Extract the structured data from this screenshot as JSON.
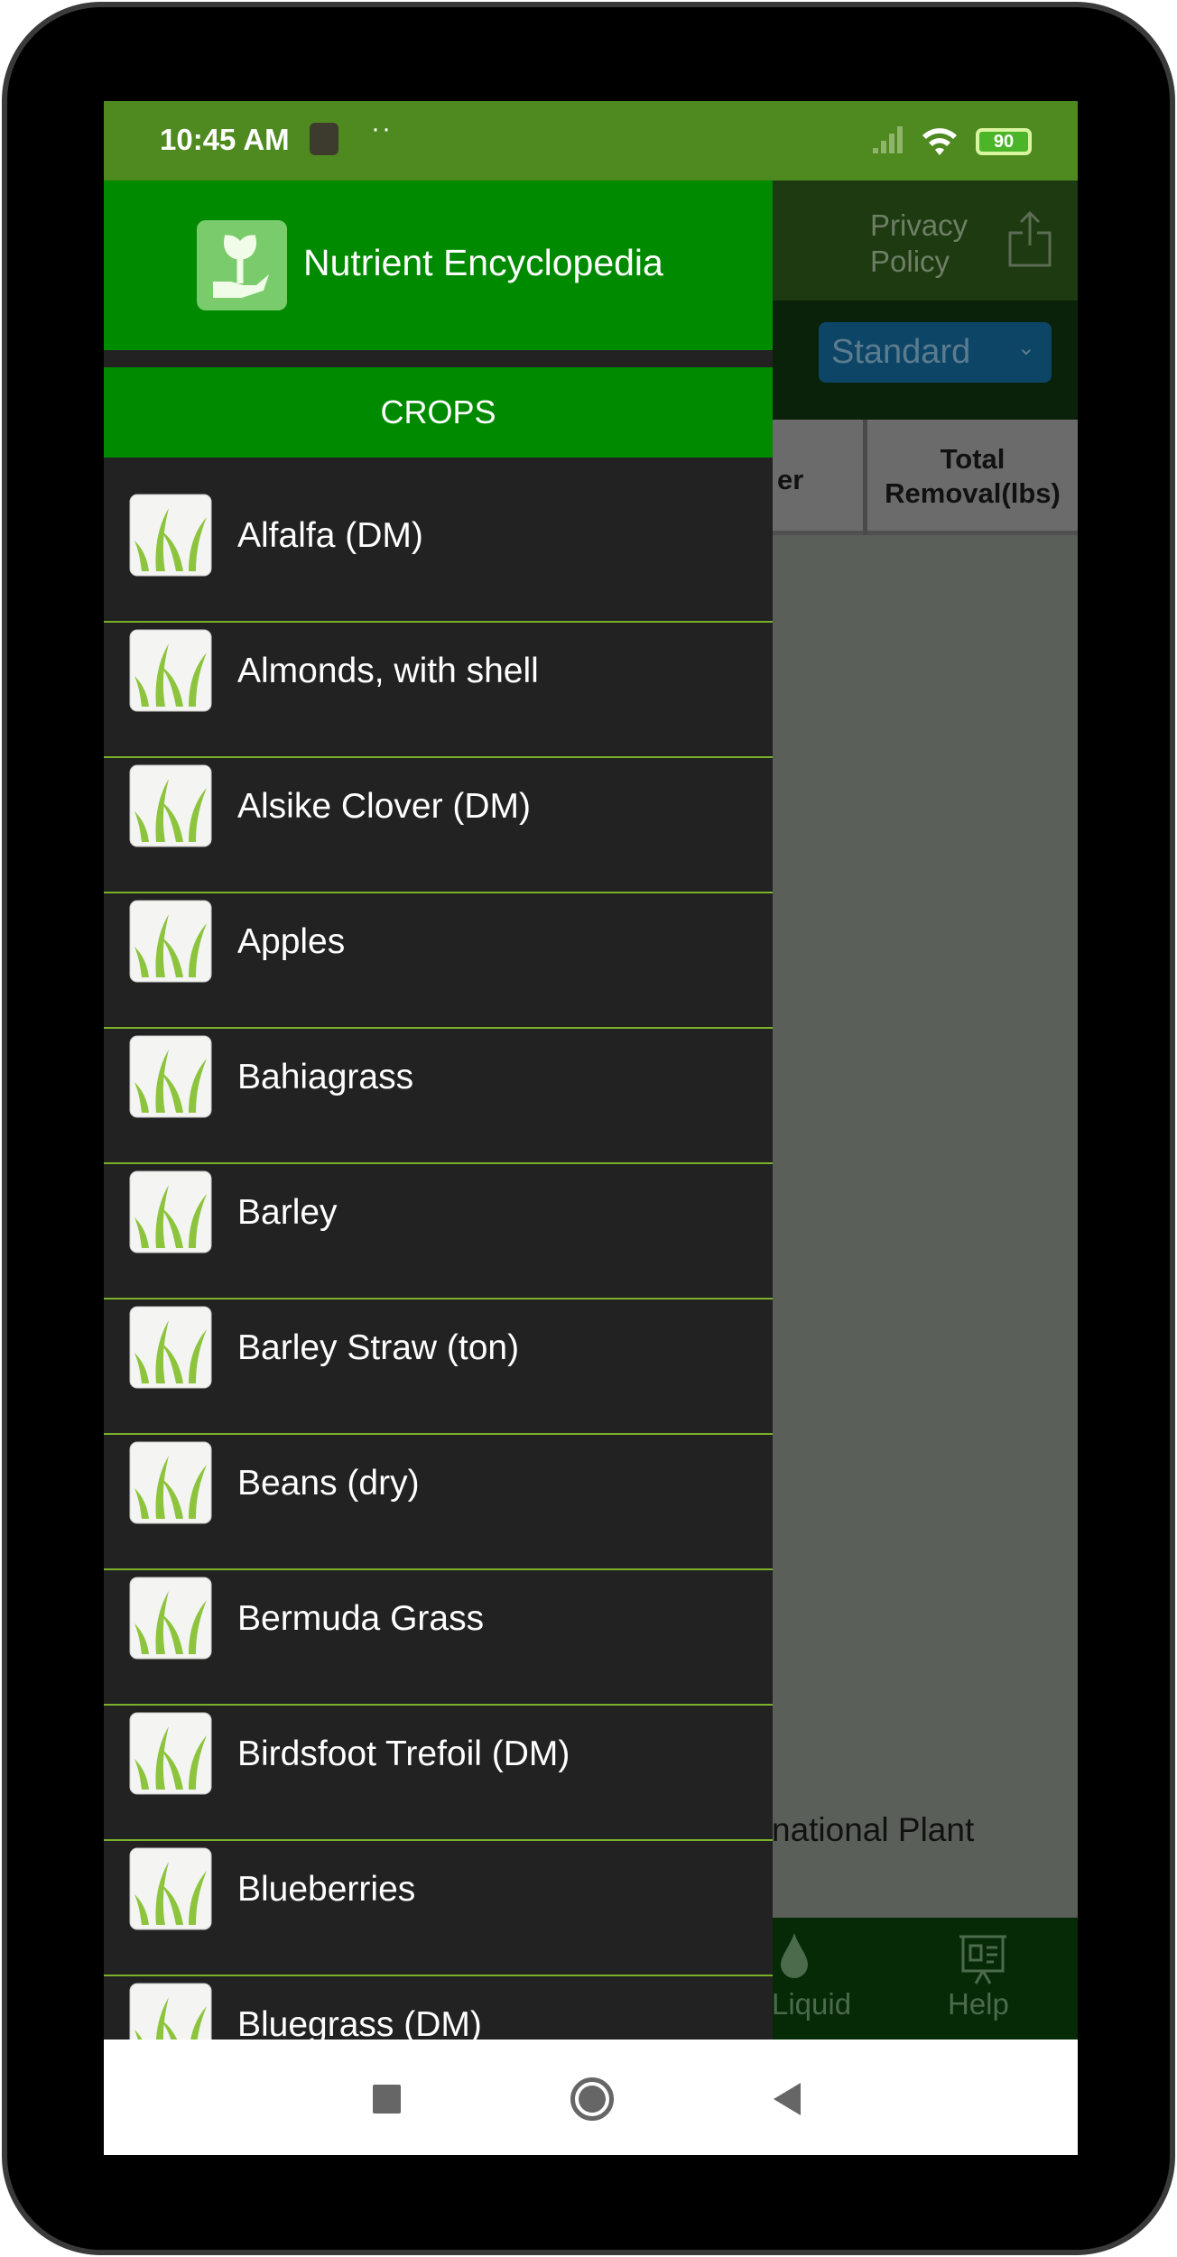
{
  "status_bar": {
    "time": "10:45 AM",
    "battery": "90"
  },
  "background": {
    "privacy_policy": "Privacy Policy",
    "unit_select": "Standard",
    "table_headers": [
      "er",
      "Total Removal(lbs)"
    ],
    "body_text": "national Plant",
    "bottom_nav": [
      {
        "label": "Liquid",
        "icon": "drop-icon"
      },
      {
        "label": "Help",
        "icon": "presentation-icon"
      }
    ]
  },
  "drawer": {
    "title": "Nutrient Encyclopedia",
    "section": "CROPS",
    "items": [
      "Alfalfa (DM)",
      "Almonds, with shell",
      "Alsike Clover (DM)",
      "Apples",
      "Bahiagrass",
      "Barley",
      "Barley Straw (ton)",
      "Beans (dry)",
      "Bermuda Grass",
      "Birdsfoot Trefoil (DM)",
      "Blueberries",
      "Bluegrass (DM)"
    ]
  },
  "colors": {
    "status": "#4f8a20",
    "drawer_header": "#008a00",
    "drawer_bg": "#222222",
    "divider": "#7bb02a"
  }
}
